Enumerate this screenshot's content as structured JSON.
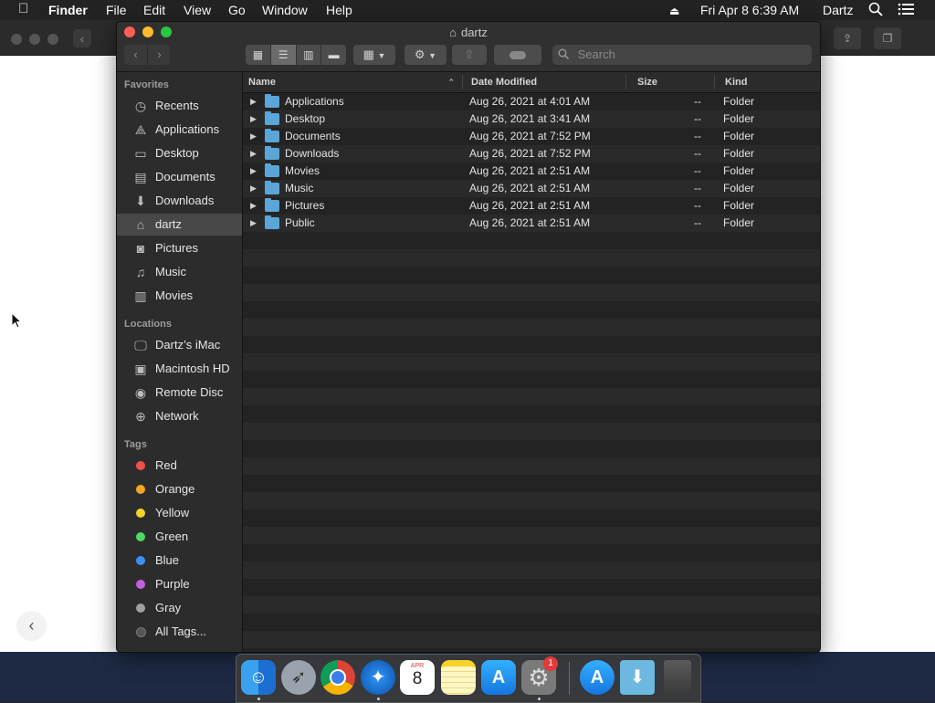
{
  "menubar": {
    "app_name": "Finder",
    "menus": [
      "File",
      "Edit",
      "View",
      "Go",
      "Window",
      "Help"
    ],
    "datetime": "Fri Apr 8  6:39 AM",
    "user": "Dartz"
  },
  "window": {
    "title": "dartz",
    "search_placeholder": "Search"
  },
  "sidebar": {
    "favorites_header": "Favorites",
    "favorites": [
      {
        "label": "Recents",
        "icon": "clock-icon"
      },
      {
        "label": "Applications",
        "icon": "applications-icon"
      },
      {
        "label": "Desktop",
        "icon": "desktop-icon"
      },
      {
        "label": "Documents",
        "icon": "document-icon"
      },
      {
        "label": "Downloads",
        "icon": "download-icon"
      },
      {
        "label": "dartz",
        "icon": "home-icon"
      },
      {
        "label": "Pictures",
        "icon": "camera-icon"
      },
      {
        "label": "Music",
        "icon": "music-note-icon"
      },
      {
        "label": "Movies",
        "icon": "film-icon"
      }
    ],
    "locations_header": "Locations",
    "locations": [
      {
        "label": "Dartz’s iMac",
        "icon": "imac-icon"
      },
      {
        "label": "Macintosh HD",
        "icon": "hard-drive-icon"
      },
      {
        "label": "Remote Disc",
        "icon": "disc-icon"
      },
      {
        "label": "Network",
        "icon": "globe-icon"
      }
    ],
    "tags_header": "Tags",
    "tags": [
      {
        "label": "Red",
        "color": "#f0504a"
      },
      {
        "label": "Orange",
        "color": "#f5a623"
      },
      {
        "label": "Yellow",
        "color": "#f5d328"
      },
      {
        "label": "Green",
        "color": "#4cd964"
      },
      {
        "label": "Blue",
        "color": "#3b8ff0"
      },
      {
        "label": "Purple",
        "color": "#c160e0"
      },
      {
        "label": "Gray",
        "color": "#a0a0a0"
      },
      {
        "label": "All Tags...",
        "color": "#555555"
      }
    ]
  },
  "list": {
    "columns": {
      "name": "Name",
      "date": "Date Modified",
      "size": "Size",
      "kind": "Kind"
    },
    "rows": [
      {
        "name": "Applications",
        "date": "Aug 26, 2021 at 4:01 AM",
        "size": "--",
        "kind": "Folder"
      },
      {
        "name": "Desktop",
        "date": "Aug 26, 2021 at 3:41 AM",
        "size": "--",
        "kind": "Folder"
      },
      {
        "name": "Documents",
        "date": "Aug 26, 2021 at 7:52 PM",
        "size": "--",
        "kind": "Folder"
      },
      {
        "name": "Downloads",
        "date": "Aug 26, 2021 at 7:52 PM",
        "size": "--",
        "kind": "Folder"
      },
      {
        "name": "Movies",
        "date": "Aug 26, 2021 at 2:51 AM",
        "size": "--",
        "kind": "Folder"
      },
      {
        "name": "Music",
        "date": "Aug 26, 2021 at 2:51 AM",
        "size": "--",
        "kind": "Folder"
      },
      {
        "name": "Pictures",
        "date": "Aug 26, 2021 at 2:51 AM",
        "size": "--",
        "kind": "Folder"
      },
      {
        "name": "Public",
        "date": "Aug 26, 2021 at 2:51 AM",
        "size": "--",
        "kind": "Folder"
      }
    ]
  },
  "dock": {
    "calendar_month": "APR",
    "calendar_day": "8",
    "badge_count": "1",
    "apps": [
      "finder-icon",
      "launchpad-icon",
      "chrome-icon",
      "safari-icon",
      "calendar-icon",
      "notes-icon",
      "app-store-icon",
      "system-preferences-icon",
      "app-store-folder-icon",
      "downloads-folder-icon",
      "trash-icon"
    ]
  }
}
